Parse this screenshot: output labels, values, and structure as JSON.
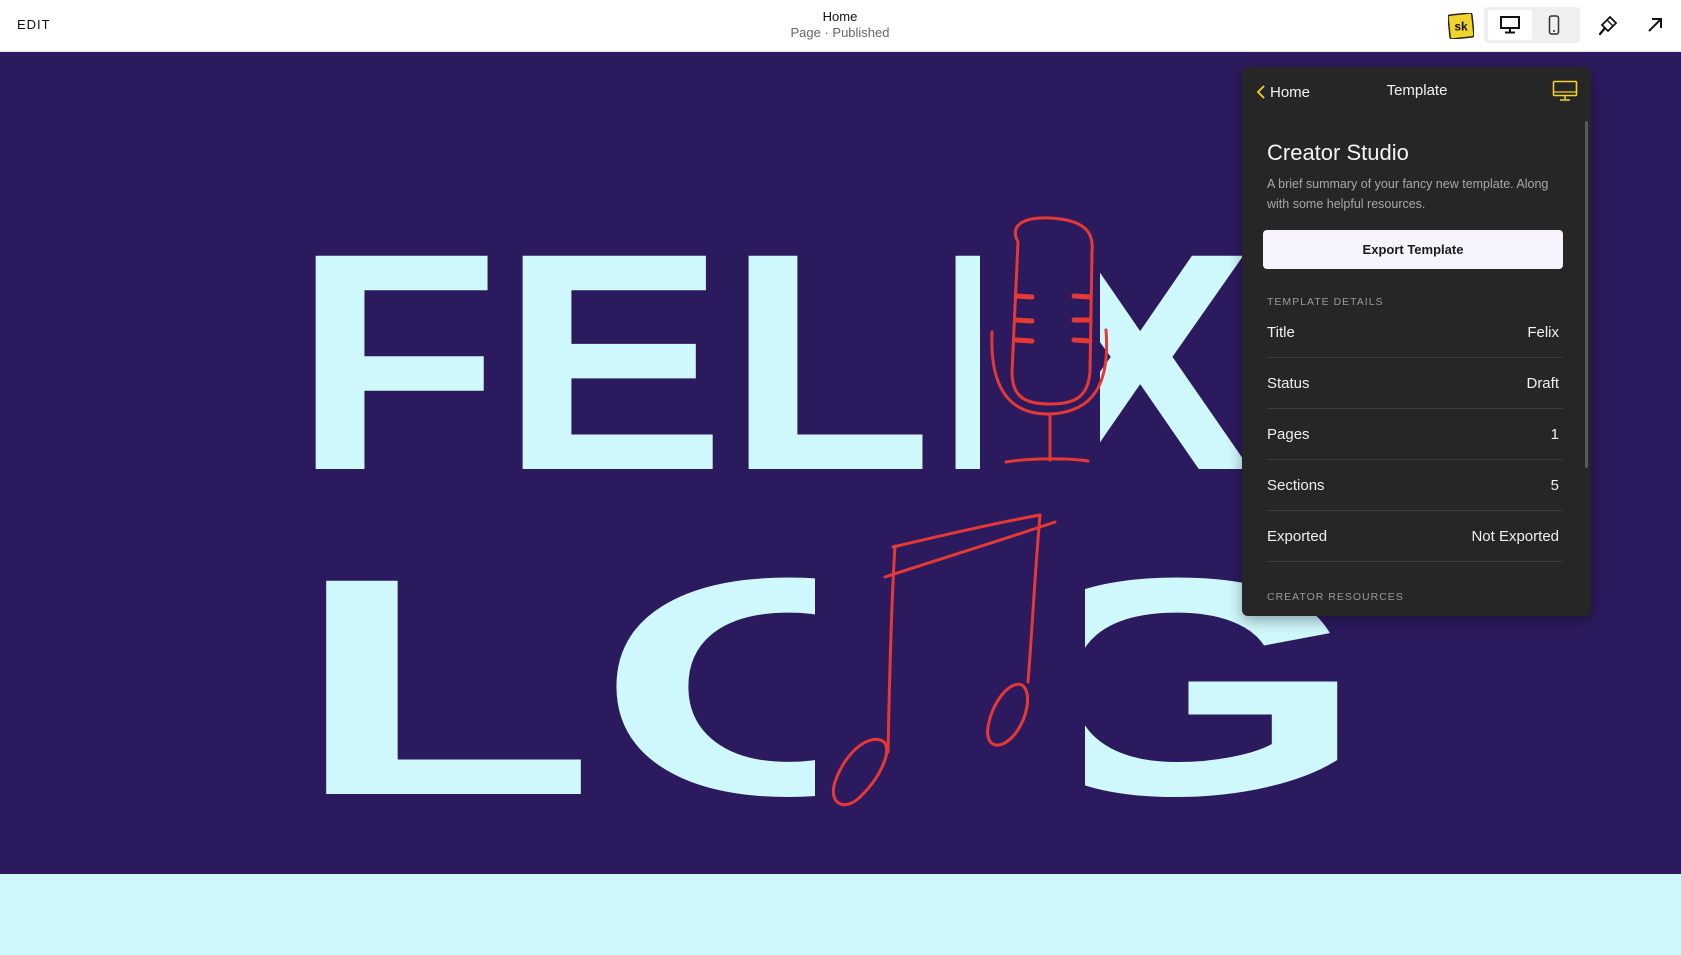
{
  "topbar": {
    "edit_label": "EDIT",
    "page_title": "Home",
    "page_status": "Page · Published",
    "logo_text": "sk"
  },
  "panel": {
    "back_label": "Home",
    "title": "Template",
    "studio_name": "Creator Studio",
    "description": "A brief summary of your fancy new template. Along with some helpful resources.",
    "export_label": "Export Template",
    "details_heading": "TEMPLATE DETAILS",
    "details": [
      {
        "key": "Title",
        "value": "Felix"
      },
      {
        "key": "Status",
        "value": "Draft"
      },
      {
        "key": "Pages",
        "value": "1"
      },
      {
        "key": "Sections",
        "value": "5"
      },
      {
        "key": "Exported",
        "value": "Not Exported"
      }
    ],
    "resources_heading": "CREATOR RESOURCES"
  },
  "hero": {
    "line1": "FELIX",
    "line2": "LOG"
  },
  "colors": {
    "canvas_bg": "#2c1a5e",
    "hero_text": "#cff8fc",
    "doodle": "#e53935",
    "panel_bg": "#262626",
    "accent": "#f2d32c"
  }
}
